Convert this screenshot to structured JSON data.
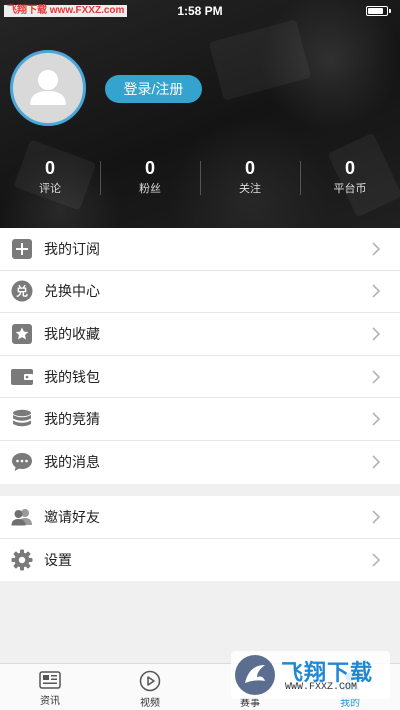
{
  "status_bar": {
    "time": "1:58 PM",
    "battery_level": 0.9,
    "watermark": "飞翔下载 www.FXXZ.com"
  },
  "profile": {
    "login_label": "登录/注册",
    "avatar_icon": "user-silhouette-icon"
  },
  "stats": [
    {
      "value": "0",
      "label": "评论"
    },
    {
      "value": "0",
      "label": "粉丝"
    },
    {
      "value": "0",
      "label": "关注"
    },
    {
      "value": "0",
      "label": "平台币"
    }
  ],
  "menu_group1": [
    {
      "label": "我的订阅",
      "icon": "plus-square-icon"
    },
    {
      "label": "兑换中心",
      "icon": "exchange-icon"
    },
    {
      "label": "我的收藏",
      "icon": "star-icon"
    },
    {
      "label": "我的钱包",
      "icon": "wallet-icon"
    },
    {
      "label": "我的竞猜",
      "icon": "coin-stack-icon"
    },
    {
      "label": "我的消息",
      "icon": "chat-bubble-icon"
    }
  ],
  "menu_group2": [
    {
      "label": "邀请好友",
      "icon": "friends-icon"
    },
    {
      "label": "设置",
      "icon": "gear-icon"
    }
  ],
  "exchange_icon_glyph": "兑",
  "tabbar": [
    {
      "label": "资讯",
      "icon": "news-icon",
      "active": false
    },
    {
      "label": "视频",
      "icon": "play-icon",
      "active": false
    },
    {
      "label": "赛事",
      "icon": "trophy-icon",
      "active": false
    },
    {
      "label": "我的",
      "icon": "profile-icon",
      "active": true
    }
  ],
  "watermark_bottom": {
    "title": "飞翔下载",
    "url": "WWW.FXXZ.COM"
  },
  "colors": {
    "accent": "#34a3cd",
    "avatar_ring": "#4aa6d9",
    "tab_active": "#2196d3",
    "icon_gray": "#7a7a7a"
  }
}
